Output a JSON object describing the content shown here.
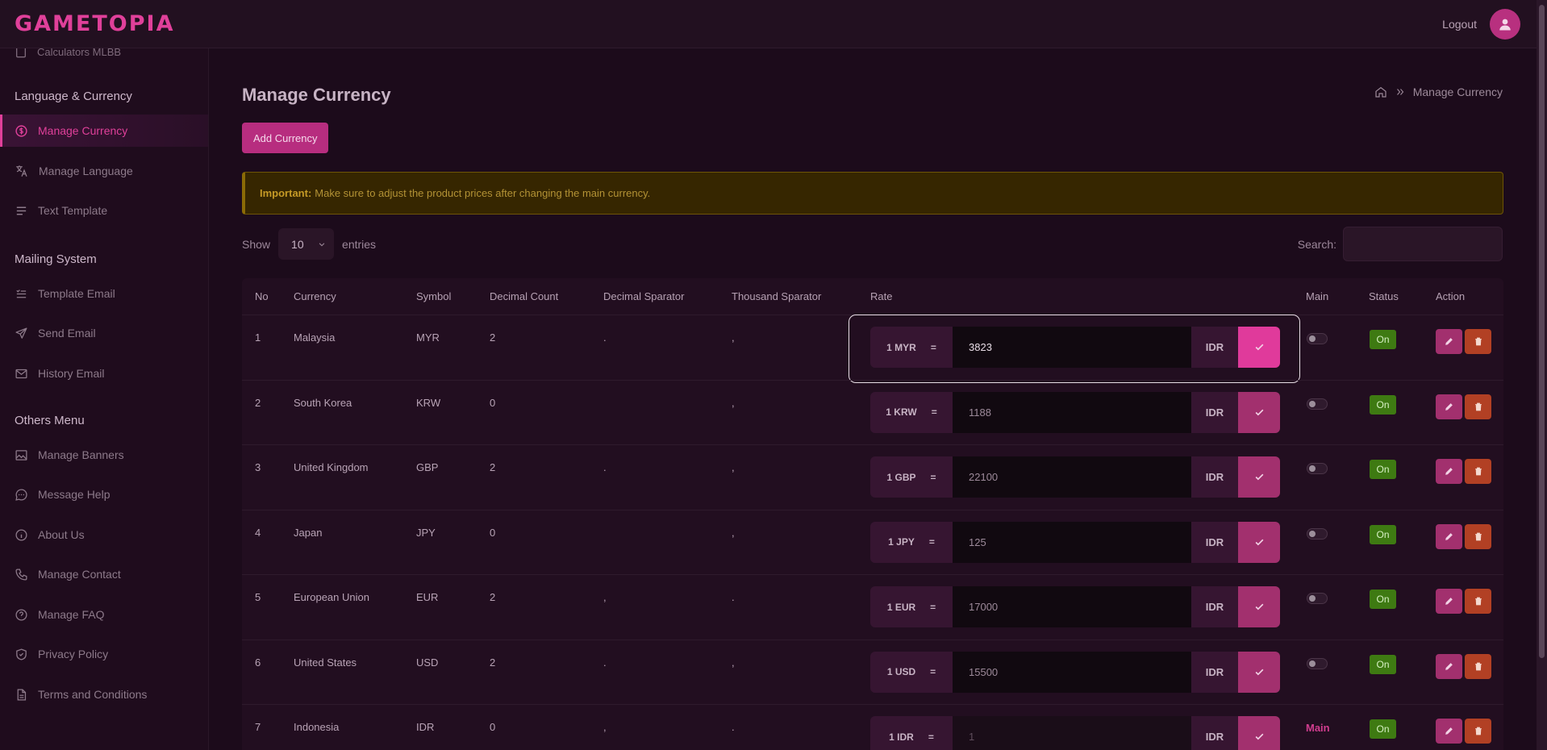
{
  "brand": {
    "logo": "GAMETOPIA",
    "accent": "#e0409a"
  },
  "header": {
    "logout_label": "Logout",
    "avatar_icon": "user-icon"
  },
  "sidebar": {
    "cut_item": "Calculators MLBB",
    "sections": [
      {
        "title": "Language & Currency",
        "items": [
          {
            "label": "Manage Currency",
            "icon": "currency-icon",
            "active": true
          },
          {
            "label": "Manage Language",
            "icon": "translate-icon"
          },
          {
            "label": "Text Template",
            "icon": "lines-icon"
          }
        ]
      },
      {
        "title": "Mailing System",
        "items": [
          {
            "label": "Template Email",
            "icon": "list-icon"
          },
          {
            "label": "Send Email",
            "icon": "send-icon"
          },
          {
            "label": "History Email",
            "icon": "mail-icon"
          }
        ]
      },
      {
        "title": "Others Menu",
        "items": [
          {
            "label": "Manage Banners",
            "icon": "image-icon"
          },
          {
            "label": "Message Help",
            "icon": "chat-icon"
          },
          {
            "label": "About Us",
            "icon": "info-icon"
          },
          {
            "label": "Manage Contact",
            "icon": "phone-icon"
          },
          {
            "label": "Manage FAQ",
            "icon": "help-icon"
          },
          {
            "label": "Privacy Policy",
            "icon": "shield-icon"
          },
          {
            "label": "Terms and Conditions",
            "icon": "file-icon"
          }
        ]
      }
    ]
  },
  "page": {
    "title": "Manage Currency",
    "breadcrumb_current": "Manage Currency",
    "add_button": "Add Currency",
    "alert_strong": "Important:",
    "alert_text": "Make sure to adjust the product prices after changing the main currency.",
    "show_label": "Show",
    "entries_value": "10",
    "entries_label": "entries",
    "search_label": "Search:"
  },
  "table": {
    "headers": [
      "No",
      "Currency",
      "Symbol",
      "Decimal Count",
      "Decimal Sparator",
      "Thousand Sparator",
      "Rate",
      "Main",
      "Status",
      "Action"
    ],
    "rows": [
      {
        "no": "1",
        "currency": "Malaysia",
        "symbol": "MYR",
        "decimal_count": "2",
        "decimal_sep": ".",
        "thousand_sep": ",",
        "rate_label": "1 MYR",
        "rate_value": "3823",
        "rate_base": "IDR",
        "main": false,
        "status": "On",
        "focused": true
      },
      {
        "no": "2",
        "currency": "South Korea",
        "symbol": "KRW",
        "decimal_count": "0",
        "decimal_sep": "",
        "thousand_sep": ",",
        "rate_label": "1 KRW",
        "rate_value": "1188",
        "rate_base": "IDR",
        "main": false,
        "status": "On"
      },
      {
        "no": "3",
        "currency": "United Kingdom",
        "symbol": "GBP",
        "decimal_count": "2",
        "decimal_sep": ".",
        "thousand_sep": ",",
        "rate_label": "1 GBP",
        "rate_value": "22100",
        "rate_base": "IDR",
        "main": false,
        "status": "On"
      },
      {
        "no": "4",
        "currency": "Japan",
        "symbol": "JPY",
        "decimal_count": "0",
        "decimal_sep": "",
        "thousand_sep": ",",
        "rate_label": "1 JPY",
        "rate_value": "125",
        "rate_base": "IDR",
        "main": false,
        "status": "On"
      },
      {
        "no": "5",
        "currency": "European Union",
        "symbol": "EUR",
        "decimal_count": "2",
        "decimal_sep": ",",
        "thousand_sep": ".",
        "rate_label": "1 EUR",
        "rate_value": "17000",
        "rate_base": "IDR",
        "main": false,
        "status": "On"
      },
      {
        "no": "6",
        "currency": "United States",
        "symbol": "USD",
        "decimal_count": "2",
        "decimal_sep": ".",
        "thousand_sep": ",",
        "rate_label": "1 USD",
        "rate_value": "15500",
        "rate_base": "IDR",
        "main": false,
        "status": "On"
      },
      {
        "no": "7",
        "currency": "Indonesia",
        "symbol": "IDR",
        "decimal_count": "0",
        "decimal_sep": ",",
        "thousand_sep": ".",
        "rate_label": "1 IDR",
        "rate_value": "1",
        "rate_base": "IDR",
        "main": true,
        "main_label": "Main",
        "status": "On"
      }
    ]
  }
}
